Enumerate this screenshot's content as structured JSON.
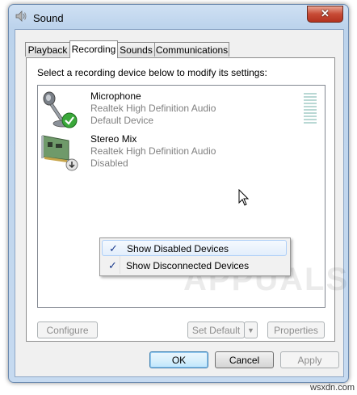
{
  "window": {
    "title": "Sound",
    "close_glyph": "✕"
  },
  "tabs": [
    {
      "label": "Playback",
      "active": false
    },
    {
      "label": "Recording",
      "active": true
    },
    {
      "label": "Sounds",
      "active": false
    },
    {
      "label": "Communications",
      "active": false
    }
  ],
  "panel": {
    "instruction": "Select a recording device below to modify its settings:"
  },
  "devices": [
    {
      "name": "Microphone",
      "driver": "Realtek High Definition Audio",
      "status": "Default Device",
      "icon": "microphone-icon",
      "badge": "default-check-icon"
    },
    {
      "name": "Stereo Mix",
      "driver": "Realtek High Definition Audio",
      "status": "Disabled",
      "icon": "sound-card-icon",
      "badge": "disabled-arrow-icon"
    }
  ],
  "watermark": "APPUALS",
  "context_menu": {
    "items": [
      {
        "label": "Show Disabled Devices",
        "checked": true,
        "check": "✓"
      },
      {
        "label": "Show Disconnected Devices",
        "checked": true,
        "check": "✓"
      }
    ]
  },
  "panel_buttons": {
    "configure": "Configure",
    "set_default": "Set Default",
    "dropdown": "▼",
    "properties": "Properties"
  },
  "dialog_buttons": {
    "ok": "OK",
    "cancel": "Cancel",
    "apply": "Apply"
  },
  "footer": {
    "watermark": "wsxdn.com"
  },
  "colors": {
    "accent": "#3c7fb1",
    "check": "#1a3a8c",
    "close": "#c74a35",
    "level_meter": "#b9d8d4"
  }
}
